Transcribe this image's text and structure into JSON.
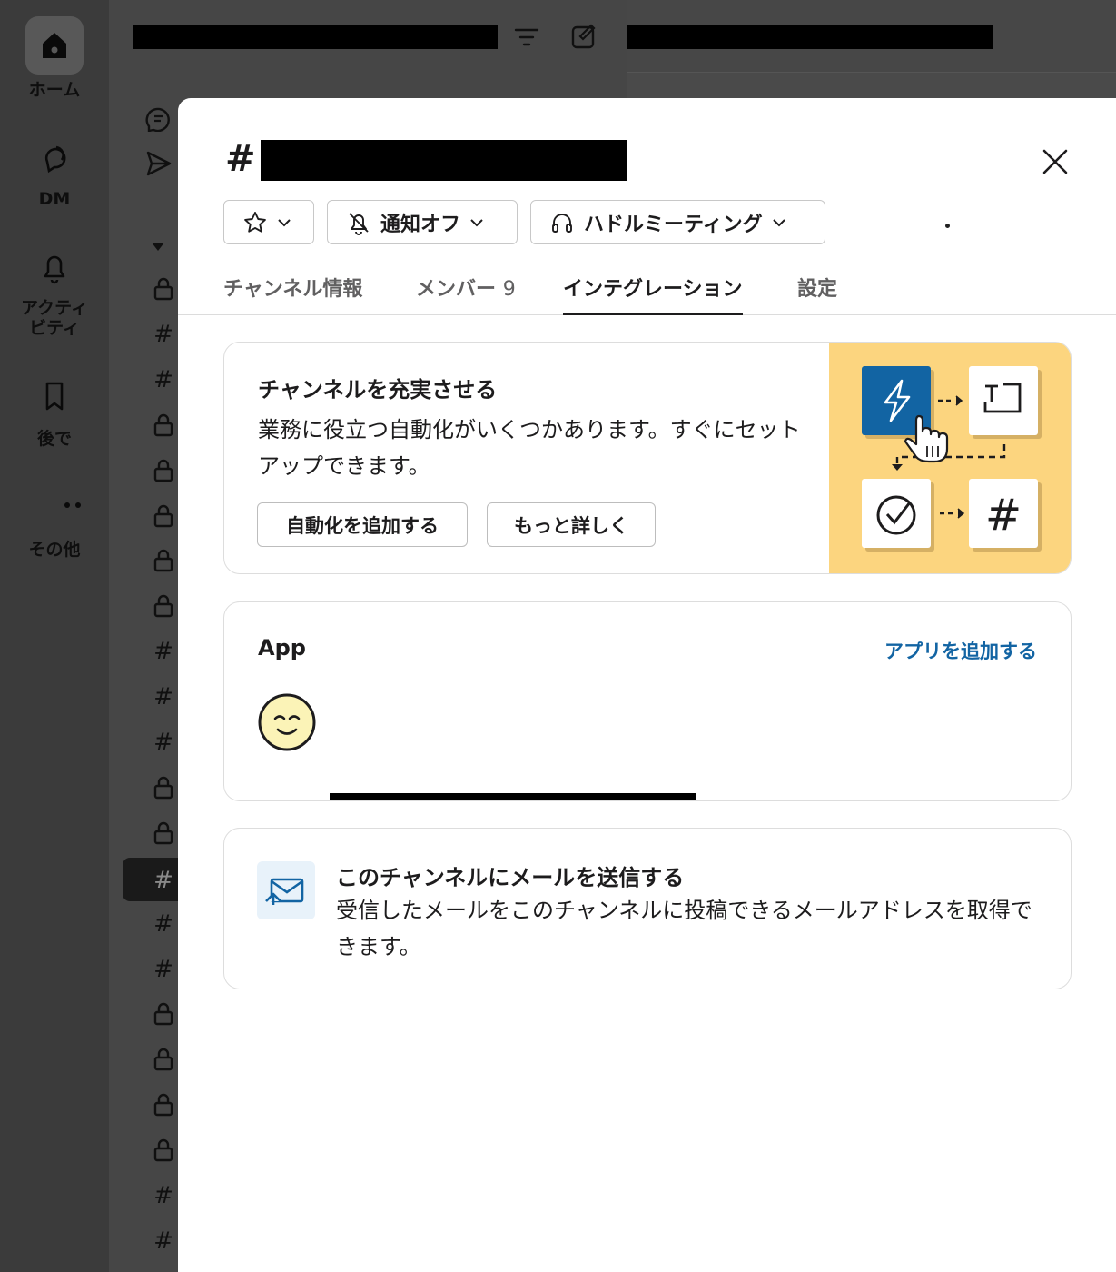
{
  "rail": {
    "home": "ホーム",
    "dm": "DM",
    "activity": "アクティ\nビティ",
    "later": "後で",
    "more": "その他"
  },
  "sidebar": {
    "rows": [
      "lock",
      "#",
      "#",
      "lock",
      "lock",
      "lock",
      "lock",
      "lock",
      "#",
      "#",
      "#",
      "lock",
      "lock",
      "#",
      "#",
      "#",
      "lock",
      "lock",
      "lock",
      "lock",
      "#",
      "#"
    ],
    "active_index": 13
  },
  "modal": {
    "title_prefix": "#",
    "pills": {
      "notify": "通知オフ",
      "huddle": "ハドルミーティング"
    },
    "tabs": {
      "info": "チャンネル情報",
      "members": "メンバー",
      "members_count": "9",
      "integrations": "インテグレーション",
      "settings": "設定"
    },
    "promo": {
      "title": "チャンネルを充実させる",
      "desc": "業務に役立つ自動化がいくつかあります。すぐにセットアップできます。",
      "add_button": "自動化を追加する",
      "learn_button": "もっと詳しく"
    },
    "apps": {
      "title": "App",
      "add_link": "アプリを追加する"
    },
    "mail": {
      "title": "このチャンネルにメールを送信する",
      "desc": "受信したメールをこのチャンネルに投稿できるメールアドレスを取得できます。"
    }
  },
  "colors": {
    "accent_link": "#1264a3",
    "promo_bg": "#fcd57f",
    "bolt_tile": "#1264a3"
  }
}
